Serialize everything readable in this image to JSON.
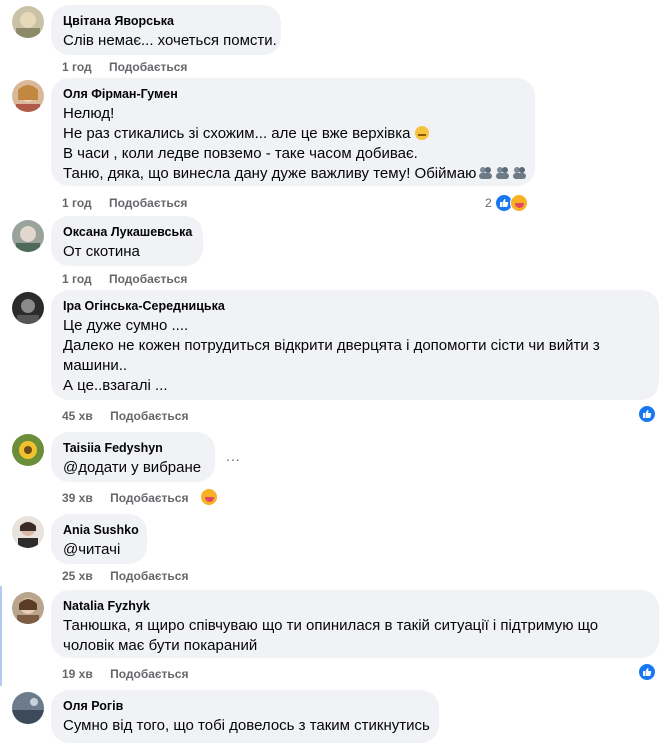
{
  "comments": [
    {
      "name": "Цвітана Яворська",
      "lines": [
        "Слів немає... хочеться помсти."
      ],
      "time": "1 год",
      "like": "Подобається"
    },
    {
      "name": "Оля Фірман-Гумен",
      "lines": [
        "Нелюд!",
        "Не раз стикались зі схожим... але це вже верхівка",
        "В часи , коли ледве повземо - таке часом добиває.",
        "Таню, дяка, що винесла дану дуже важливу тему! Обіймаю"
      ],
      "time": "1 год",
      "like": "Подобається",
      "reactions_count": "2",
      "emoji_icon": "unamused-face-icon",
      "hug_icon": "people-hugging-icon"
    },
    {
      "name": "Оксана Лукашевська",
      "lines": [
        "От скотина"
      ],
      "time": "1 год",
      "like": "Подобається"
    },
    {
      "name": "Іра Огінська-Середницька",
      "lines": [
        "Це дуже сумно ....",
        "Далеко не кожен потрудиться відкрити дверцята і допомогти сісти чи вийти з",
        "машини..",
        "А це..взагалі ..."
      ],
      "time": "45 хв",
      "like": "Подобається"
    },
    {
      "name": "Taisiia Fedyshyn",
      "lines": [
        "@додати у вибране"
      ],
      "time": "39 хв",
      "like": "Подобається",
      "more": "..."
    },
    {
      "name": "Ania Sushko",
      "lines": [
        "@читачі"
      ],
      "time": "25 хв",
      "like": "Подобається"
    },
    {
      "name": "Natalia Fyzhyk",
      "lines": [
        "Танюшка, я щиро співчуваю що ти опинилася в такій ситуації і підтримую що",
        "чоловік має бути покараний"
      ],
      "time": "19 хв",
      "like": "Подобається"
    },
    {
      "name": "Оля Рогів",
      "lines": [
        "Сумно від того, що тобі довелось з таким стикнутись"
      ]
    }
  ],
  "colors": {
    "bubble": "#f0f2f5",
    "meta": "#65676b",
    "like_blue": "#1877f2",
    "thread_bar": "#b3c9ef"
  }
}
